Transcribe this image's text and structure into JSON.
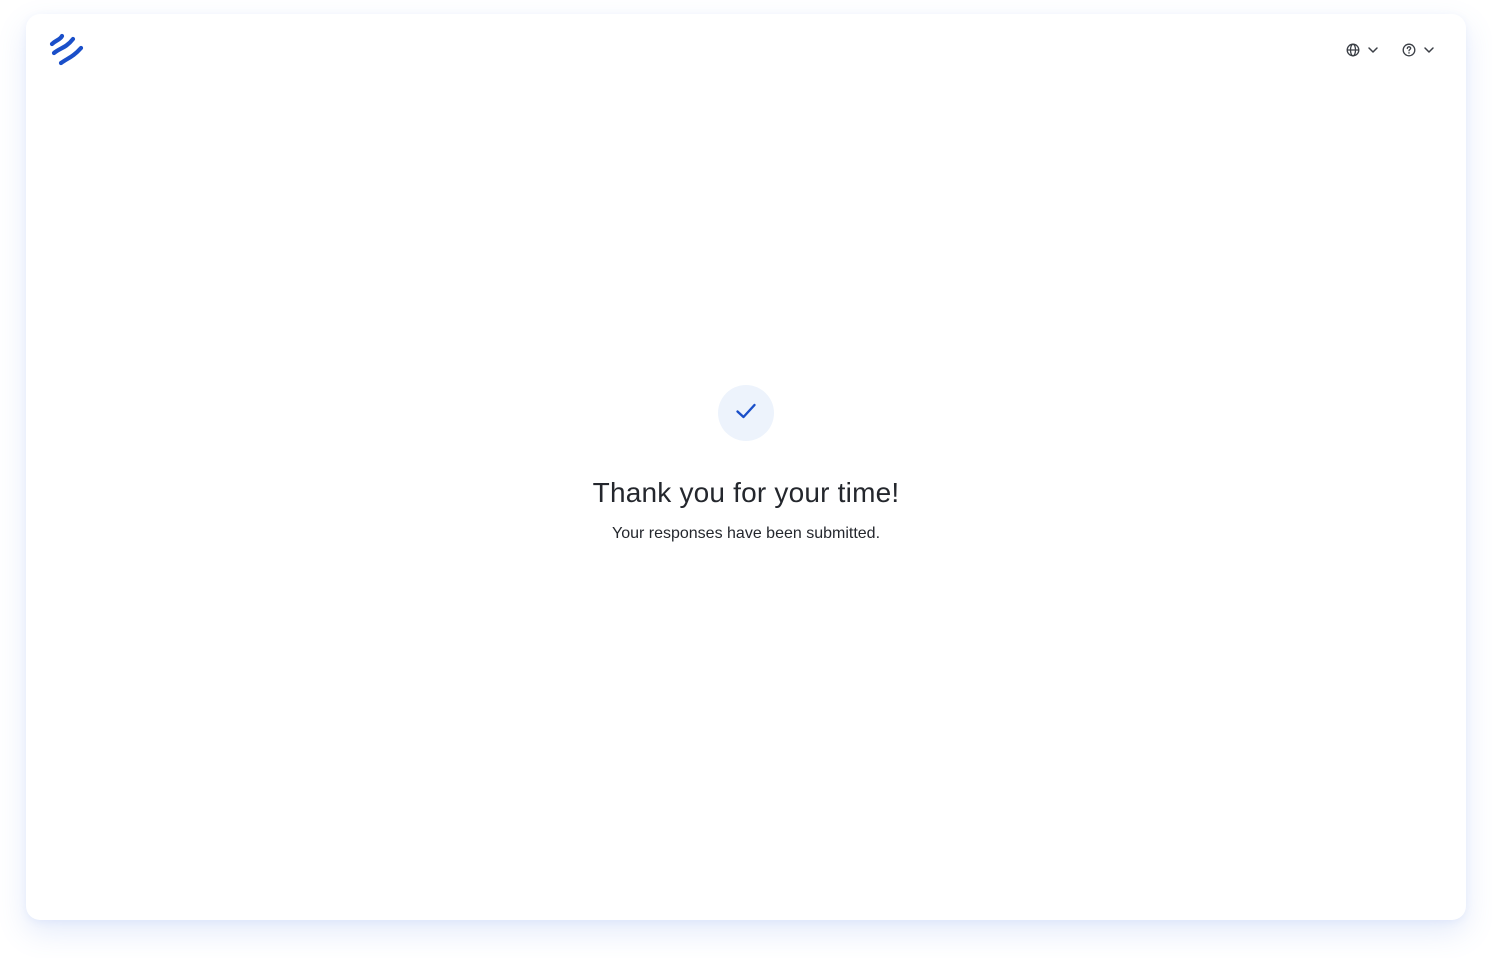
{
  "header": {
    "logo_icon": "brand-logo-icon",
    "language_icon": "globe-icon",
    "help_icon": "help-circle-icon",
    "chevron_icon": "chevron-down-icon"
  },
  "main": {
    "status_icon": "checkmark-icon",
    "title": "Thank you for your time!",
    "subtitle": "Your responses have been submitted."
  },
  "colors": {
    "brand": "#1a4fc9",
    "icon": "#3b3f46",
    "text": "#24272d",
    "check_bg": "#edf3fc"
  }
}
